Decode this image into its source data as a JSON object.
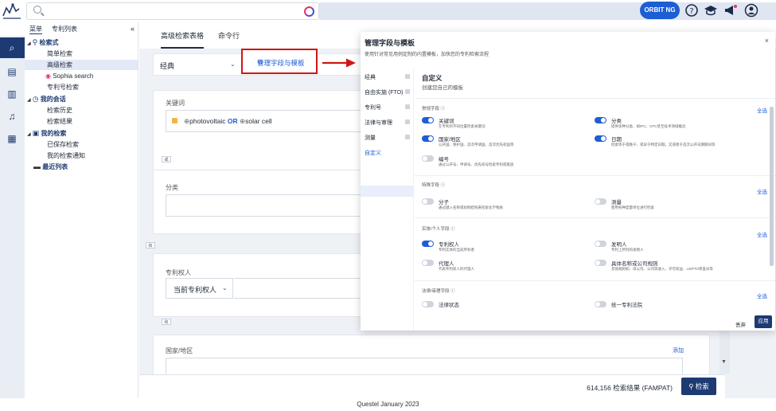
{
  "topbar": {
    "search_placeholder": "",
    "orbit_label": "ORBIT NG",
    "icons": [
      "help-icon",
      "graduation-cap-icon",
      "megaphone-icon",
      "user-icon"
    ],
    "brand_color": "#1d5ed3"
  },
  "left_panel": {
    "tabs": [
      "菜单",
      "专利列表"
    ],
    "collapse": "«",
    "tree": {
      "search_section": "检索式",
      "simple_search": "简单检索",
      "advanced_search": "高级检索",
      "sophia_search": "Sophia search",
      "patent_number_search": "专利号检索",
      "session_section": "我的会话",
      "search_history": "检索历史",
      "search_results": "检索结果",
      "my_searches_section": "我的检索",
      "saved_searches": "已保存检索",
      "search_alerts": "我的检索通知",
      "recent_lists": "最近列表"
    }
  },
  "main": {
    "tabs": [
      "高级检索表格",
      "命令行"
    ],
    "template_select": "经典",
    "manage_fields_button": "管理字段与模板",
    "keyword_label": "关键词",
    "keyword_query": {
      "term1": "photovoltaic",
      "operator": "OR",
      "term2": "solar cell"
    },
    "connector_1": "或",
    "classification_label": "分类",
    "connector_2": "和",
    "assignee_label": "专利权人",
    "assignee_select": "当前专利权人",
    "connector_3": "和",
    "country_label": "国家/地区",
    "add_link": "添加"
  },
  "bottom": {
    "results": "614,156 检索结果 (FAMPAT)",
    "search_button": "检索"
  },
  "footer": "Questel January 2023",
  "modal": {
    "title": "管理字段与模板",
    "subtitle": "使用针对常见用例定制的内置模板，加快您的专利检索流程",
    "close": "×",
    "nav": [
      "经典",
      "自由实施 (FTO)",
      "专利号",
      "法律与审理",
      "测量",
      "自定义"
    ],
    "selected_nav": "自定义",
    "content_title": "自定义",
    "content_subtitle": "创建您自己的模板",
    "select_all": "全选",
    "sections": [
      {
        "title": "常规字段",
        "options": [
          {
            "name": "关键词",
            "desc": "在专利的不同位置检索关键词",
            "on": true
          },
          {
            "name": "分类",
            "desc": "提供多种分类、如IPC、CPC甚至技术领域概念",
            "on": true
          },
          {
            "name": "国家/地区",
            "desc": "公开国、保护国、首次申请国、首次优先权国等",
            "on": true
          },
          {
            "name": "日期",
            "desc": "检索等于或晚于、或早于特定日期。又或者于首次公开日期期间等",
            "on": true
          },
          {
            "name": "编号",
            "desc": "通过公开号、申请号、优先权号检索专利或家族",
            "on": false
          }
        ]
      },
      {
        "title": "特殊字段",
        "options": [
          {
            "name": "分子",
            "desc": "通过键入名称或绘制结构来检索化学物质",
            "on": false
          },
          {
            "name": "测量",
            "desc": "使用各种度量单位进行检索",
            "on": false
          }
        ]
      },
      {
        "title": "实体/个人字段",
        "options": [
          {
            "name": "专利权人",
            "desc": "专利实体的当前所有者",
            "on": true
          },
          {
            "name": "发明人",
            "desc": "专利上所列的发明人",
            "on": false
          },
          {
            "name": "代理人",
            "desc": "代表专利权人的代理人",
            "on": false
          },
          {
            "name": "具体名称或公司规则",
            "desc": "其他规则如：母公司、公司等收入、许可权益、USPTO审查员等",
            "on": false
          }
        ]
      },
      {
        "title": "法律/审理字段",
        "options": [
          {
            "name": "法律状态",
            "desc": "",
            "on": false
          },
          {
            "name": "统一专利法院",
            "desc": "",
            "on": false
          }
        ]
      }
    ],
    "discard": "丢弃",
    "apply": "应用"
  }
}
